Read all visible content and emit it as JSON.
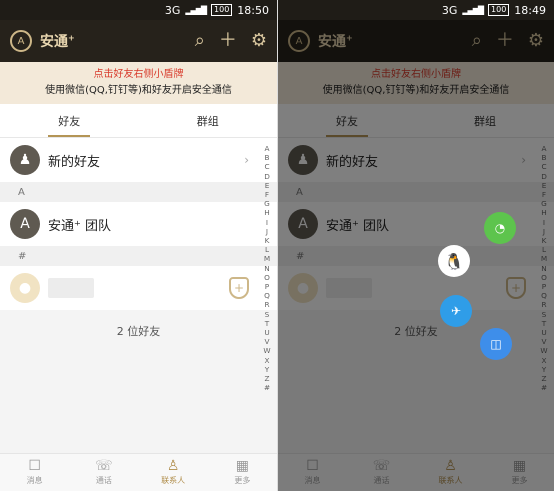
{
  "left": {
    "status": {
      "time": "18:50",
      "network": "3G",
      "battery": "100"
    },
    "app": {
      "title": "安通",
      "title_sup": "+"
    },
    "banner": {
      "line1": "点击好友右侧小盾牌",
      "line2": "使用微信(QQ,钉钉等)和好友开启安全通信"
    },
    "tabs": {
      "friends": "好友",
      "groups": "群组"
    },
    "rows": {
      "new_friends": "新的好友",
      "section_a": "A",
      "team": "安通⁺ 团队",
      "section_hash": "#"
    },
    "footer_count": "2 位好友",
    "nav": {
      "messages": "消息",
      "calls": "通话",
      "contacts": "联系人",
      "more": "更多"
    }
  },
  "right": {
    "status": {
      "time": "18:49",
      "network": "3G",
      "battery": "100"
    },
    "app": {
      "title": "安通",
      "title_sup": "+"
    },
    "banner": {
      "line1": "点击好友右侧小盾牌",
      "line2": "使用微信(QQ,钉钉等)和好友开启安全通信"
    },
    "tabs": {
      "friends": "好友",
      "groups": "群组"
    },
    "rows": {
      "new_friends": "新的好友",
      "section_a": "A",
      "team": "安通⁺ 团队",
      "section_hash": "#"
    },
    "footer_count": "2 位好友",
    "nav": {
      "messages": "消息",
      "calls": "通话",
      "contacts": "联系人",
      "more": "更多"
    }
  },
  "index_letters": [
    "A",
    "B",
    "C",
    "D",
    "E",
    "F",
    "G",
    "H",
    "I",
    "J",
    "K",
    "L",
    "M",
    "N",
    "O",
    "P",
    "Q",
    "R",
    "S",
    "T",
    "U",
    "V",
    "W",
    "X",
    "Y",
    "Z",
    "#"
  ],
  "icons": {
    "logo": "shield-logo-icon",
    "search": "search-icon",
    "add": "plus-icon",
    "settings": "gear-icon",
    "shield": "small-shield-icon",
    "wechat": "wechat-icon",
    "qq": "qq-icon",
    "dingtalk": "dingtalk-icon",
    "other": "share-icon"
  },
  "colors": {
    "accent": "#b49556",
    "dark": "#26221b",
    "banner": "#f3e9d9"
  }
}
